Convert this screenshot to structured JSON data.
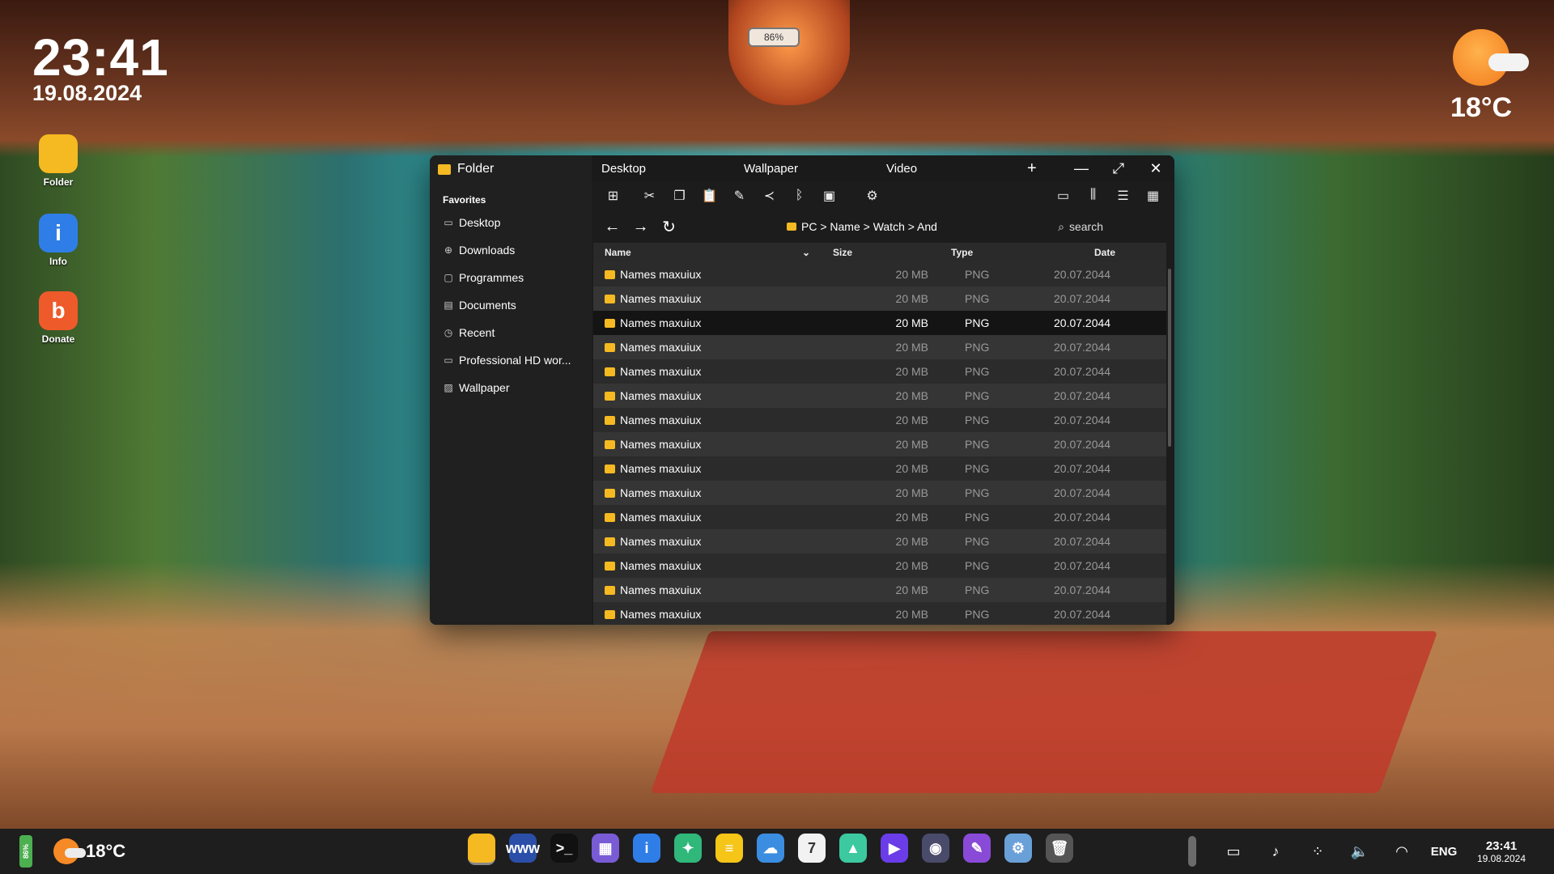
{
  "desktop": {
    "clock_time": "23:41",
    "clock_date": "19.08.2024",
    "weather_temp": "18°C",
    "battery_percent": "86%",
    "icons": [
      {
        "label": "Folder",
        "icon": "folder-icon",
        "color": "#f5b921"
      },
      {
        "label": "Info",
        "icon": "info-icon",
        "color": "#2f7ee8"
      },
      {
        "label": "Donate",
        "icon": "donate-icon",
        "color": "#ef5a2a"
      }
    ]
  },
  "window": {
    "title": "Folder",
    "tabs": [
      "Desktop",
      "Wallpaper",
      "Video"
    ],
    "add_tab": "+",
    "controls": {
      "minimize": "—",
      "maximize": "⤢",
      "close": "✕"
    },
    "sidebar": {
      "section": "Favorites",
      "items": [
        {
          "label": "Desktop",
          "icon": "monitor-icon"
        },
        {
          "label": "Downloads",
          "icon": "download-icon"
        },
        {
          "label": "Programmes",
          "icon": "window-icon"
        },
        {
          "label": "Documents",
          "icon": "document-icon"
        },
        {
          "label": "Recent",
          "icon": "clock-icon"
        },
        {
          "label": "Professional HD wor...",
          "icon": "folder-outline-icon"
        },
        {
          "label": "Wallpaper",
          "icon": "image-icon"
        }
      ]
    },
    "toolbar": {
      "left": [
        "new-folder-icon",
        "cut-icon",
        "copy-icon",
        "paste-icon",
        "rename-icon",
        "share-icon",
        "bluetooth-icon",
        "archive-icon",
        "folder-settings-icon"
      ],
      "right": [
        "view-preview-icon",
        "view-columns-icon",
        "view-list-icon",
        "view-grid-icon"
      ]
    },
    "breadcrumb": "PC > Name > Watch > And",
    "search_placeholder": "search",
    "columns": {
      "name": "Name",
      "size": "Size",
      "type": "Type",
      "date": "Date"
    },
    "rows": [
      {
        "name": "Names maxuiux",
        "size": "20 MB",
        "type": "PNG",
        "date": "20.07.2044",
        "selected": false
      },
      {
        "name": "Names maxuiux",
        "size": "20 MB",
        "type": "PNG",
        "date": "20.07.2044",
        "selected": false
      },
      {
        "name": "Names maxuiux",
        "size": "20 MB",
        "type": "PNG",
        "date": "20.07.2044",
        "selected": true
      },
      {
        "name": "Names maxuiux",
        "size": "20 MB",
        "type": "PNG",
        "date": "20.07.2044",
        "selected": false
      },
      {
        "name": "Names maxuiux",
        "size": "20 MB",
        "type": "PNG",
        "date": "20.07.2044",
        "selected": false
      },
      {
        "name": "Names maxuiux",
        "size": "20 MB",
        "type": "PNG",
        "date": "20.07.2044",
        "selected": false
      },
      {
        "name": "Names maxuiux",
        "size": "20 MB",
        "type": "PNG",
        "date": "20.07.2044",
        "selected": false
      },
      {
        "name": "Names maxuiux",
        "size": "20 MB",
        "type": "PNG",
        "date": "20.07.2044",
        "selected": false
      },
      {
        "name": "Names maxuiux",
        "size": "20 MB",
        "type": "PNG",
        "date": "20.07.2044",
        "selected": false
      },
      {
        "name": "Names maxuiux",
        "size": "20 MB",
        "type": "PNG",
        "date": "20.07.2044",
        "selected": false
      },
      {
        "name": "Names maxuiux",
        "size": "20 MB",
        "type": "PNG",
        "date": "20.07.2044",
        "selected": false
      },
      {
        "name": "Names maxuiux",
        "size": "20 MB",
        "type": "PNG",
        "date": "20.07.2044",
        "selected": false
      },
      {
        "name": "Names maxuiux",
        "size": "20 MB",
        "type": "PNG",
        "date": "20.07.2044",
        "selected": false
      },
      {
        "name": "Names maxuiux",
        "size": "20 MB",
        "type": "PNG",
        "date": "20.07.2044",
        "selected": false
      },
      {
        "name": "Names maxuiux",
        "size": "20 MB",
        "type": "PNG",
        "date": "20.07.2044",
        "selected": false
      }
    ]
  },
  "taskbar": {
    "battery": "86%",
    "weather_temp": "18°C",
    "apps": [
      {
        "name": "files-app-icon",
        "color": "#f5b921",
        "glyph": "",
        "active": true
      },
      {
        "name": "browser-app-icon",
        "color": "#2b4fa8",
        "glyph": "www",
        "active": false
      },
      {
        "name": "terminal-app-icon",
        "color": "#111111",
        "glyph": ">_",
        "active": false
      },
      {
        "name": "calculator-app-icon",
        "color": "#7a5bd6",
        "glyph": "▦",
        "active": false
      },
      {
        "name": "info-app-icon",
        "color": "#2f7ee8",
        "glyph": "i",
        "active": false
      },
      {
        "name": "tools-app-icon",
        "color": "#2fb87a",
        "glyph": "✦",
        "active": false
      },
      {
        "name": "notes-app-icon",
        "color": "#f5c518",
        "glyph": "≡",
        "active": false
      },
      {
        "name": "weather-app-icon",
        "color": "#3a8de0",
        "glyph": "☁",
        "active": false
      },
      {
        "name": "calendar-app-icon",
        "color": "#f2f2f2",
        "glyph": "7",
        "active": false
      },
      {
        "name": "photos-app-icon",
        "color": "#3cc9a0",
        "glyph": "▲",
        "active": false
      },
      {
        "name": "video-app-icon",
        "color": "#6a3de8",
        "glyph": "▶",
        "active": false
      },
      {
        "name": "camera-app-icon",
        "color": "#4a4a6a",
        "glyph": "◉",
        "active": false
      },
      {
        "name": "paint-app-icon",
        "color": "#8a4ad8",
        "glyph": "✎",
        "active": false
      },
      {
        "name": "settings-app-icon",
        "color": "#6aa0d8",
        "glyph": "⚙",
        "active": false
      },
      {
        "name": "trash-app-icon",
        "color": "#555555",
        "glyph": "🗑",
        "active": false
      }
    ],
    "tray": {
      "icons": [
        "tablet-mode-icon",
        "music-icon",
        "apps-grid-icon",
        "volume-icon",
        "wifi-icon"
      ],
      "language": "ENG",
      "time": "23:41",
      "date": "19.08.2024"
    }
  }
}
